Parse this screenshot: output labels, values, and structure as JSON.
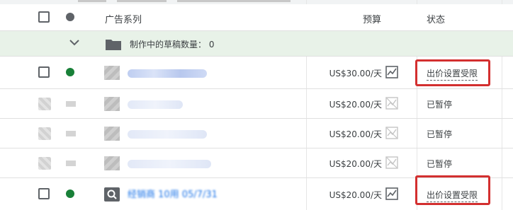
{
  "header": {
    "campaign_col": "广告系列",
    "budget_col": "预算",
    "status_col": "状态"
  },
  "draft_row": {
    "label": "制作中的草稿数量： 0"
  },
  "rows": [
    {
      "budget": "US$30.00/天",
      "status": "出价设置受限",
      "status_style": "limited",
      "highlighted": true,
      "enabled": true
    },
    {
      "budget": "US$20.00/天",
      "status": "已暂停",
      "status_style": "paused",
      "highlighted": false,
      "enabled": false
    },
    {
      "budget": "US$20.00/天",
      "status": "已暂停",
      "status_style": "paused",
      "highlighted": false,
      "enabled": false
    },
    {
      "budget": "US$20.00/天",
      "status": "已暂停",
      "status_style": "paused",
      "highlighted": false,
      "enabled": false
    },
    {
      "budget": "US$20.00/天",
      "status": "出价设置受限",
      "status_style": "limited",
      "highlighted": true,
      "enabled": true,
      "campaign_name": "经销商 10用 05/7/31"
    }
  ],
  "colors": {
    "active_dot": "#188038",
    "highlight_border": "#d32f2f",
    "draft_bg": "#e8f2e8",
    "link": "#1a73e8"
  },
  "icons": {
    "expand": "chevron-down-icon",
    "folder": "folder-icon",
    "budget_report": "trend-chart-icon",
    "budget_report_disabled": "trend-chart-disabled-icon",
    "search": "search-icon"
  }
}
